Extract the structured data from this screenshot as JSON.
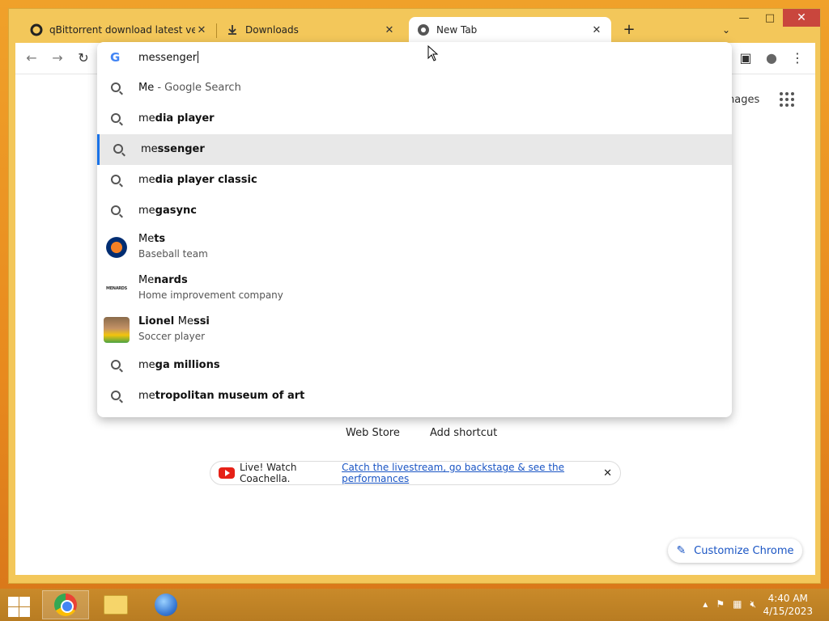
{
  "tabs": [
    {
      "title": "qBittorrent download latest versi",
      "icon": "qbittorrent-icon"
    },
    {
      "title": "Downloads",
      "icon": "download-icon"
    },
    {
      "title": "New Tab",
      "icon": "chrome-icon"
    }
  ],
  "omnibox": {
    "value": "messenger",
    "suggestions": [
      {
        "type": "search",
        "typed": "Me",
        "completion": "",
        "suffix": " - Google Search"
      },
      {
        "type": "search",
        "typed": "me",
        "completion": "dia player"
      },
      {
        "type": "search",
        "typed": "me",
        "completion": "ssenger",
        "selected": true
      },
      {
        "type": "search",
        "typed": "me",
        "completion": "dia player classic"
      },
      {
        "type": "search",
        "typed": "me",
        "completion": "gasync"
      },
      {
        "type": "entity",
        "typed": "Me",
        "completion": "ts",
        "sub": "Baseball team",
        "thumb": "mets-logo"
      },
      {
        "type": "entity",
        "typed": "Me",
        "completion": "nards",
        "sub": "Home improvement company",
        "thumb": "menards-logo"
      },
      {
        "type": "entity",
        "prefix": "Lionel ",
        "typed": "Me",
        "completion": "ssi",
        "sub": "Soccer player",
        "thumb": "messi-photo"
      },
      {
        "type": "search",
        "typed": "me",
        "completion": "ga millions"
      },
      {
        "type": "search",
        "typed": "me",
        "completion": "tropolitan museum of art"
      }
    ]
  },
  "page": {
    "images_link": "nages",
    "shortcut_web_store": "Web Store",
    "shortcut_add": "Add shortcut",
    "promo_text": "Live! Watch Coachella.",
    "promo_link": "Catch the livestream, go backstage & see the performances",
    "customize_label": "Customize Chrome",
    "menards_logo_text": "MENARDS"
  },
  "taskbar": {
    "time": "4:40 AM",
    "date": "4/15/2023"
  },
  "colors": {
    "accent": "#1a73e8",
    "link": "#1a55c4",
    "desktop": "#e88a1e",
    "window_frame": "#f3c75a"
  }
}
